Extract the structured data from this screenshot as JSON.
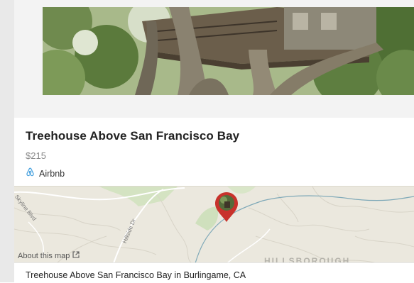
{
  "listing": {
    "title": "Treehouse Above San Francisco Bay",
    "price": "$215",
    "source": "Airbnb",
    "source_icon": "airbnb-logo-icon",
    "accent_color": "#4aa3df"
  },
  "map": {
    "about_label": "About this map",
    "about_icon": "external-link-icon",
    "streets": [
      "Skyline Blvd",
      "Hillside Dr"
    ],
    "town_label": "HILLSBOROUGH",
    "pin_color": "#c8322b"
  },
  "caption": {
    "text": "Treehouse Above San Francisco Bay in Burlingame, CA"
  },
  "hero": {
    "icon": "treehouse-photo"
  }
}
